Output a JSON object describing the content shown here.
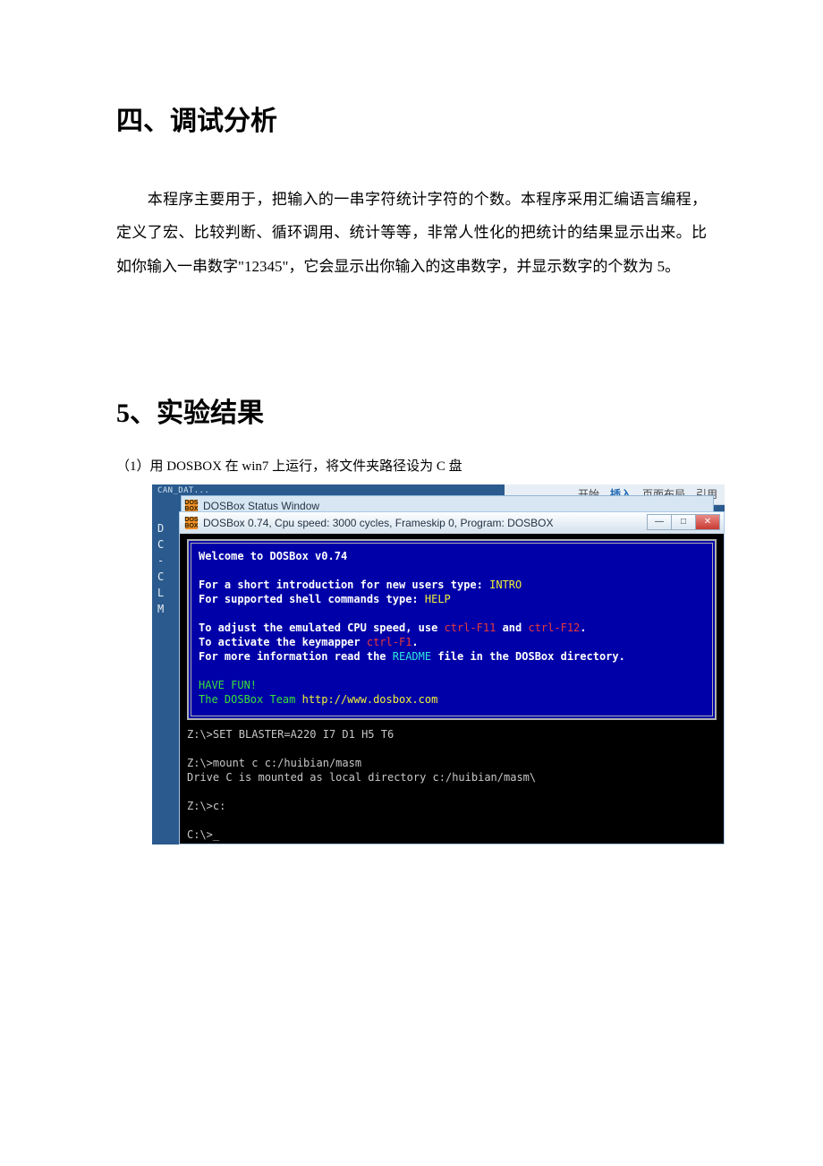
{
  "section4": {
    "heading": "四、调试分析",
    "body": "本程序主要用于，把输入的一串字符统计字符的个数。本程序采用汇编语言编程，定义了宏、比较判断、循环调用、统计等等，非常人性化的把统计的结果显示出来。比如你输入一串数字\"12345\"，它会显示出你输入的这串数字，并显示数字的个数为 5。"
  },
  "section5": {
    "heading_num": "5",
    "heading_rest": "、实验结果",
    "caption": "（1）用 DOSBOX  在 win7 上运行，将文件夹路径设为 C 盘"
  },
  "ribbon": {
    "tab1": "开始",
    "tab2": "插入",
    "tab3": "页面布局",
    "tab4": "引用"
  },
  "screenshot": {
    "snippet_top": "CAN_DAT...",
    "status_title": "DOSBox Status Window",
    "term_title": "DOSBox 0.74, Cpu speed:    3000 cycles, Frameskip  0, Program:   DOSBOX",
    "left_glyphs": "D\nC\n-\nC\nL\nM",
    "welcome_l1": "Welcome to DOSBox v0.74",
    "welcome_l3a": "For a short introduction for new users type: ",
    "welcome_l3b": "INTRO",
    "welcome_l4a": "For supported shell commands type: ",
    "welcome_l4b": "HELP",
    "welcome_l6a": "To adjust the emulated CPU speed, use ",
    "welcome_l6b": "ctrl-F11",
    "welcome_l6c": " and ",
    "welcome_l6d": "ctrl-F12",
    "welcome_l6e": ".",
    "welcome_l7a": "To activate the keymapper ",
    "welcome_l7b": "ctrl-F1",
    "welcome_l7c": ".",
    "welcome_l8a": "For more information read the ",
    "welcome_l8b": "README",
    "welcome_l8c": " file in the DOSBox directory.",
    "welcome_l10": "HAVE FUN!",
    "welcome_l11a": "The DOSBox Team ",
    "welcome_l11b": "http://www.dosbox.com",
    "con_l1": "Z:\\>SET BLASTER=A220 I7 D1 H5 T6",
    "con_l3": "Z:\\>mount c c:/huibian/masm",
    "con_l4": "Drive C is mounted as local directory c:/huibian/masm\\",
    "con_l6": "Z:\\>c:",
    "con_l8": "C:\\>_",
    "icon_text": "DOS\nBOX"
  }
}
